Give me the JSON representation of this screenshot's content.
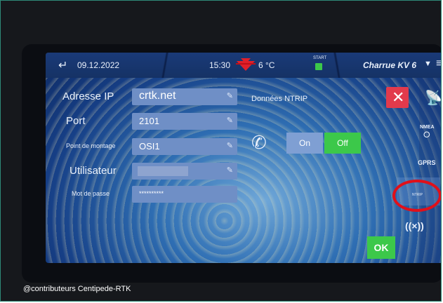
{
  "status_bar": {
    "date": "09.12.2022",
    "time": "15:30",
    "temperature": "6 °C",
    "start_label": "START",
    "implement": "Charrue KV 6"
  },
  "form": {
    "ip_label": "Adresse IP",
    "ip_value": "crtk.net",
    "port_label": "Port",
    "port_value": "2101",
    "mount_label": "Point de montage",
    "mount_value": "OSI1",
    "user_label": "Utilisateur",
    "user_value": "",
    "password_label": "Mot de passe",
    "password_value": "**********"
  },
  "ntrip": {
    "title": "Données NTRIP",
    "on_label": "On",
    "off_label": "Off",
    "selected": "Off"
  },
  "side_menu": {
    "nmea_label": "NMEA",
    "gprs_label": "GPRS",
    "rtk_label": "NTRIP",
    "wireless_label": "((×))"
  },
  "ok_label": "OK",
  "watermark": "@contributeurs Centipede-RTK",
  "colors": {
    "accent_green": "#3cc84a",
    "close_red": "#e23a4c",
    "field_blue": "#6f8fc6",
    "highlight_ring": "#e0101a",
    "frame_border": "#2f8a78"
  }
}
